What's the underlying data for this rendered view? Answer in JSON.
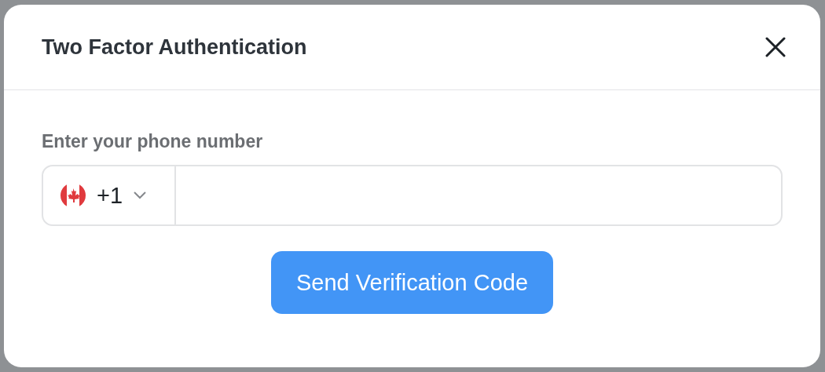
{
  "dialog": {
    "title": "Two Factor Authentication"
  },
  "phone": {
    "label": "Enter your phone number",
    "country_code": "+1"
  },
  "buttons": [
    "Send Verification Code"
  ]
}
